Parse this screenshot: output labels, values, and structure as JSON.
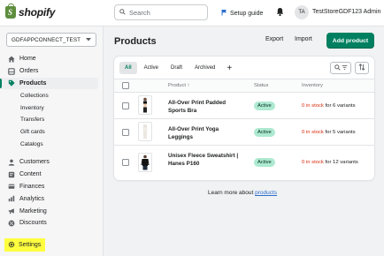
{
  "topbar": {
    "logo_text": "shopify",
    "search_placeholder": "Search",
    "setup_guide": "Setup guide",
    "avatar_initials": "TA",
    "store_admin": "TestStoreGDF123 Admin"
  },
  "sidebar": {
    "store_selector": "GDFAPPCONNECT_TEST",
    "items": [
      {
        "label": "Home",
        "icon": "home-icon"
      },
      {
        "label": "Orders",
        "icon": "orders-icon"
      },
      {
        "label": "Products",
        "icon": "tag-icon",
        "active": true
      }
    ],
    "product_subitems": [
      "Collections",
      "Inventory",
      "Transfers",
      "Gift cards",
      "Catalogs"
    ],
    "items_after": [
      {
        "label": "Customers",
        "icon": "person-icon"
      },
      {
        "label": "Content",
        "icon": "content-icon"
      },
      {
        "label": "Finances",
        "icon": "finances-icon"
      },
      {
        "label": "Analytics",
        "icon": "analytics-icon"
      },
      {
        "label": "Marketing",
        "icon": "marketing-icon"
      },
      {
        "label": "Discounts",
        "icon": "discount-icon"
      }
    ],
    "settings": "Settings",
    "highlight_color": "#ffff40"
  },
  "page": {
    "title": "Products",
    "export": "Export",
    "import": "Import",
    "add_product": "Add product",
    "primary_color": "#008060"
  },
  "tabs": [
    "All",
    "Active",
    "Draft",
    "Archived"
  ],
  "tab_add": "+",
  "table": {
    "headers": {
      "product": "Product",
      "status": "Status",
      "inventory": "Inventory"
    },
    "rows": [
      {
        "name": "All-Over Print Padded Sports Bra",
        "status": "Active",
        "inv_zero": "0 in stock",
        "inv_rest": " for 6 variants"
      },
      {
        "name": "All-Over Print Yoga Leggings",
        "status": "Active",
        "inv_zero": "0 in stock",
        "inv_rest": " for 5 variants"
      },
      {
        "name": "Unisex Fleece Sweatshirt | Hanes P160",
        "status": "Active",
        "inv_zero": "0 in stock",
        "inv_rest": " for 12 variants"
      }
    ]
  },
  "footer": {
    "learn_text": "Learn more about ",
    "learn_link": "products"
  }
}
